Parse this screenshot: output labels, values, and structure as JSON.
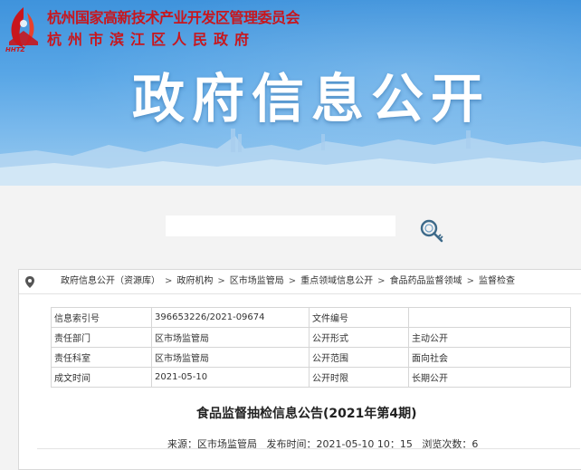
{
  "header": {
    "org_line1": "杭州国家高新技术产业开发区管理委员会",
    "org_line2": "杭州市滨江区人民政府",
    "logo_abbr": "HHTZ",
    "title": "政府信息公开"
  },
  "search": {
    "value": "",
    "icon": "magnifier-key-icon"
  },
  "breadcrumb": {
    "icon": "location-pin-icon",
    "items": [
      "政府信息公开（资源库）",
      "政府机构",
      "区市场监管局",
      "重点领域信息公开",
      "食品药品监督领域",
      "监督检查"
    ],
    "separator": ">"
  },
  "meta_table": {
    "rows": [
      {
        "k1": "信息索引号",
        "v1": "396653226/2021-09674",
        "k2": "文件编号",
        "v2": ""
      },
      {
        "k1": "责任部门",
        "v1": "区市场监管局",
        "k2": "公开形式",
        "v2": "主动公开"
      },
      {
        "k1": "责任科室",
        "v1": "区市场监管局",
        "k2": "公开范围",
        "v2": "面向社会"
      },
      {
        "k1": "成文时间",
        "v1": "2021-05-10",
        "k2": "公开时限",
        "v2": "长期公开"
      }
    ]
  },
  "article": {
    "title": "食品监督抽检信息公告(2021年第4期)",
    "source_label": "来源：",
    "source": "区市场监管局",
    "published_label": "发布时间：",
    "published": "2021-05-10 10：15",
    "views_label": "浏览次数：",
    "views": "6"
  },
  "colors": {
    "brand_red": "#c8161d",
    "banner_blue": "#4a9ae0"
  }
}
